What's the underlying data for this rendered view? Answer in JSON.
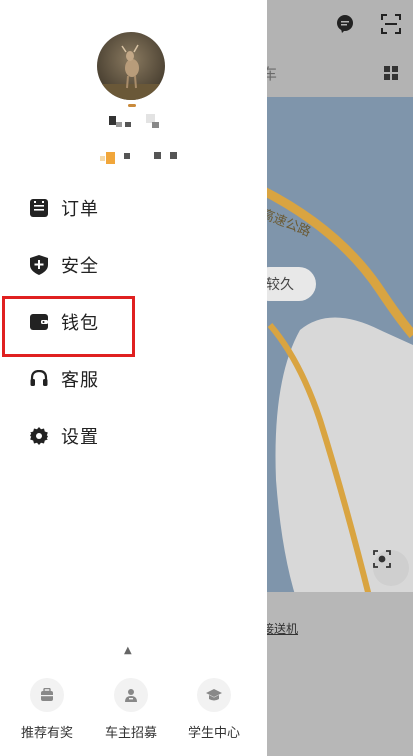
{
  "drawer": {
    "menu": [
      {
        "id": "orders",
        "label": "订单",
        "icon": "order-list-icon"
      },
      {
        "id": "security",
        "label": "安全",
        "icon": "shield-plus-icon"
      },
      {
        "id": "wallet",
        "label": "钱包",
        "icon": "wallet-icon"
      },
      {
        "id": "service",
        "label": "客服",
        "icon": "headset-icon"
      },
      {
        "id": "settings",
        "label": "设置",
        "icon": "gear-icon"
      }
    ],
    "bottom_nav": [
      {
        "label": "推荐有奖",
        "icon": "gift-icon"
      },
      {
        "label": "车主招募",
        "icon": "driver-icon"
      },
      {
        "label": "学生中心",
        "icon": "graduation-cap-icon"
      }
    ]
  },
  "map": {
    "tab_label": "车",
    "road_label": "高速公路",
    "bubble_text": "较久",
    "bottom_link": "接送机"
  },
  "colors": {
    "highlight": "#e02020",
    "road": "#d9a441"
  }
}
